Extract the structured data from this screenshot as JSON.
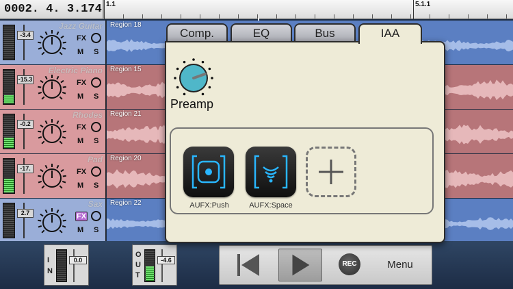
{
  "position_counter": "0002. 4. 3.174",
  "ruler": {
    "start_label": "1.1",
    "marker_label": "5.1.1"
  },
  "tracks": [
    {
      "name": "Jazz Guitar",
      "volume": "-3.4",
      "fx": "FX",
      "mute": "M",
      "solo": "S",
      "region": "Region 18",
      "header_color": "#9aaed8",
      "region_color": "#5b7fc2",
      "wave_color": "#a6bde8",
      "meter_level": 0.0,
      "fx_active": false
    },
    {
      "name": "Electric Piano",
      "volume": "-15.3",
      "fx": "FX",
      "mute": "M",
      "solo": "S",
      "region": "Region 15",
      "header_color": "#d99a9e",
      "region_color": "#b77579",
      "wave_color": "#e6b8ba",
      "meter_level": 0.25,
      "fx_active": false
    },
    {
      "name": "Rhodes",
      "volume": "-0.2",
      "fx": "FX",
      "mute": "M",
      "solo": "S",
      "region": "Region 21",
      "header_color": "#d99a9e",
      "region_color": "#b77579",
      "wave_color": "#e6b8ba",
      "meter_level": 0.3,
      "fx_active": false
    },
    {
      "name": "Pad",
      "volume": "-17.",
      "fx": "FX",
      "mute": "M",
      "solo": "S",
      "region": "Region 20",
      "header_color": "#d99a9e",
      "region_color": "#b77579",
      "wave_color": "#e6b8ba",
      "meter_level": 0.4,
      "fx_active": false
    },
    {
      "name": "Sax",
      "volume": "2.7",
      "fx": "FX",
      "mute": "M",
      "solo": "S",
      "region": "Region 22",
      "header_color": "#9aaed8",
      "region_color": "#5b7fc2",
      "wave_color": "#a6bde8",
      "meter_level": 0.0,
      "fx_active": true
    }
  ],
  "popover": {
    "tabs": [
      {
        "label": "Comp.",
        "active": false
      },
      {
        "label": "EQ",
        "active": false
      },
      {
        "label": "Bus",
        "active": false
      },
      {
        "label": "IAA",
        "active": true
      }
    ],
    "preamp_label": "Preamp",
    "preamp_knob_color": "#4fb7c9",
    "effects": [
      {
        "label": "AUFX:Push",
        "icon": "aufx-push-icon"
      },
      {
        "label": "AUFX:Space",
        "icon": "aufx-space-icon"
      }
    ],
    "add_slot_icon": "plus-icon"
  },
  "io": {
    "in": {
      "letters": [
        "I",
        "N"
      ],
      "value": "0.0",
      "meter_level": 0.0
    },
    "out": {
      "letters": [
        "O",
        "U",
        "T"
      ],
      "value": "-4.6",
      "meter_level": 0.45
    }
  },
  "transport": {
    "rewind_icon": "skip-back-icon",
    "play_icon": "play-icon",
    "rec_label": "REC",
    "menu_label": "Menu"
  },
  "colors": {
    "accent_cyan": "#29b6ff",
    "panel_bg": "#eeebd7",
    "meter_green": "#6fe06f"
  }
}
